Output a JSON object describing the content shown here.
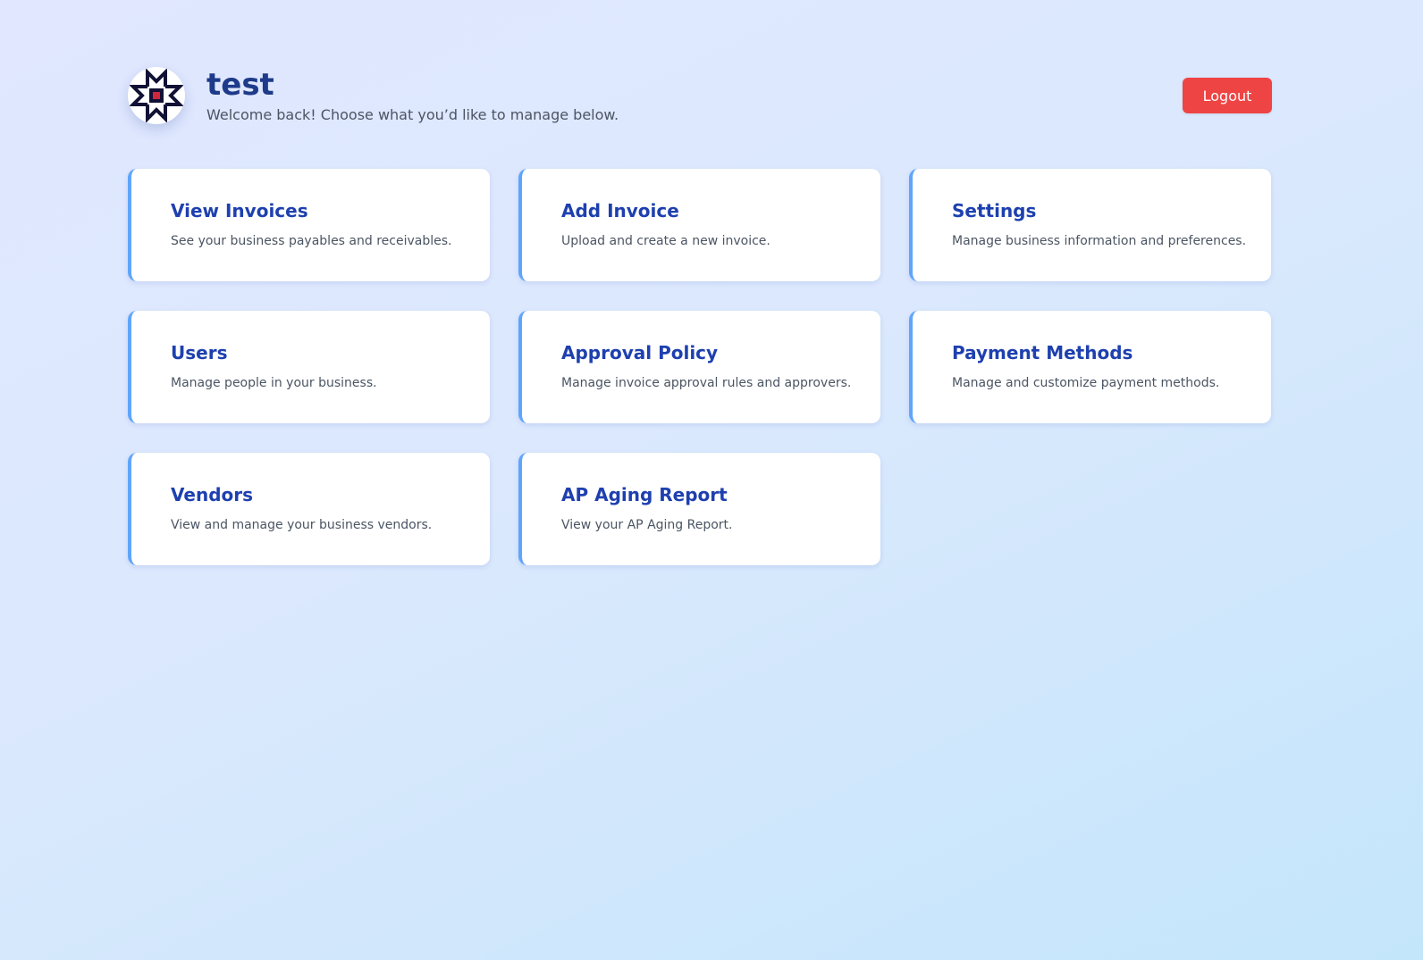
{
  "header": {
    "title": "test",
    "subtitle": "Welcome back! Choose what you’d like to manage below.",
    "logo_icon": "company-logo-icon",
    "logout_label": "Logout"
  },
  "colors": {
    "title": "#1e3a8a",
    "card_title": "#1e40af",
    "card_accent": "#60a5fa",
    "logout": "#ef4444",
    "logo_mark": "#111136",
    "logo_center": "#d1253d"
  },
  "cards": [
    {
      "title": "View Invoices",
      "description": "See your business payables and receivables."
    },
    {
      "title": "Add Invoice",
      "description": "Upload and create a new invoice."
    },
    {
      "title": "Settings",
      "description": "Manage business information and preferences."
    },
    {
      "title": "Users",
      "description": "Manage people in your business."
    },
    {
      "title": "Approval Policy",
      "description": "Manage invoice approval rules and approvers."
    },
    {
      "title": "Payment Methods",
      "description": "Manage and customize payment methods."
    },
    {
      "title": "Vendors",
      "description": "View and manage your business vendors."
    },
    {
      "title": "AP Aging Report",
      "description": "View your AP Aging Report."
    }
  ]
}
